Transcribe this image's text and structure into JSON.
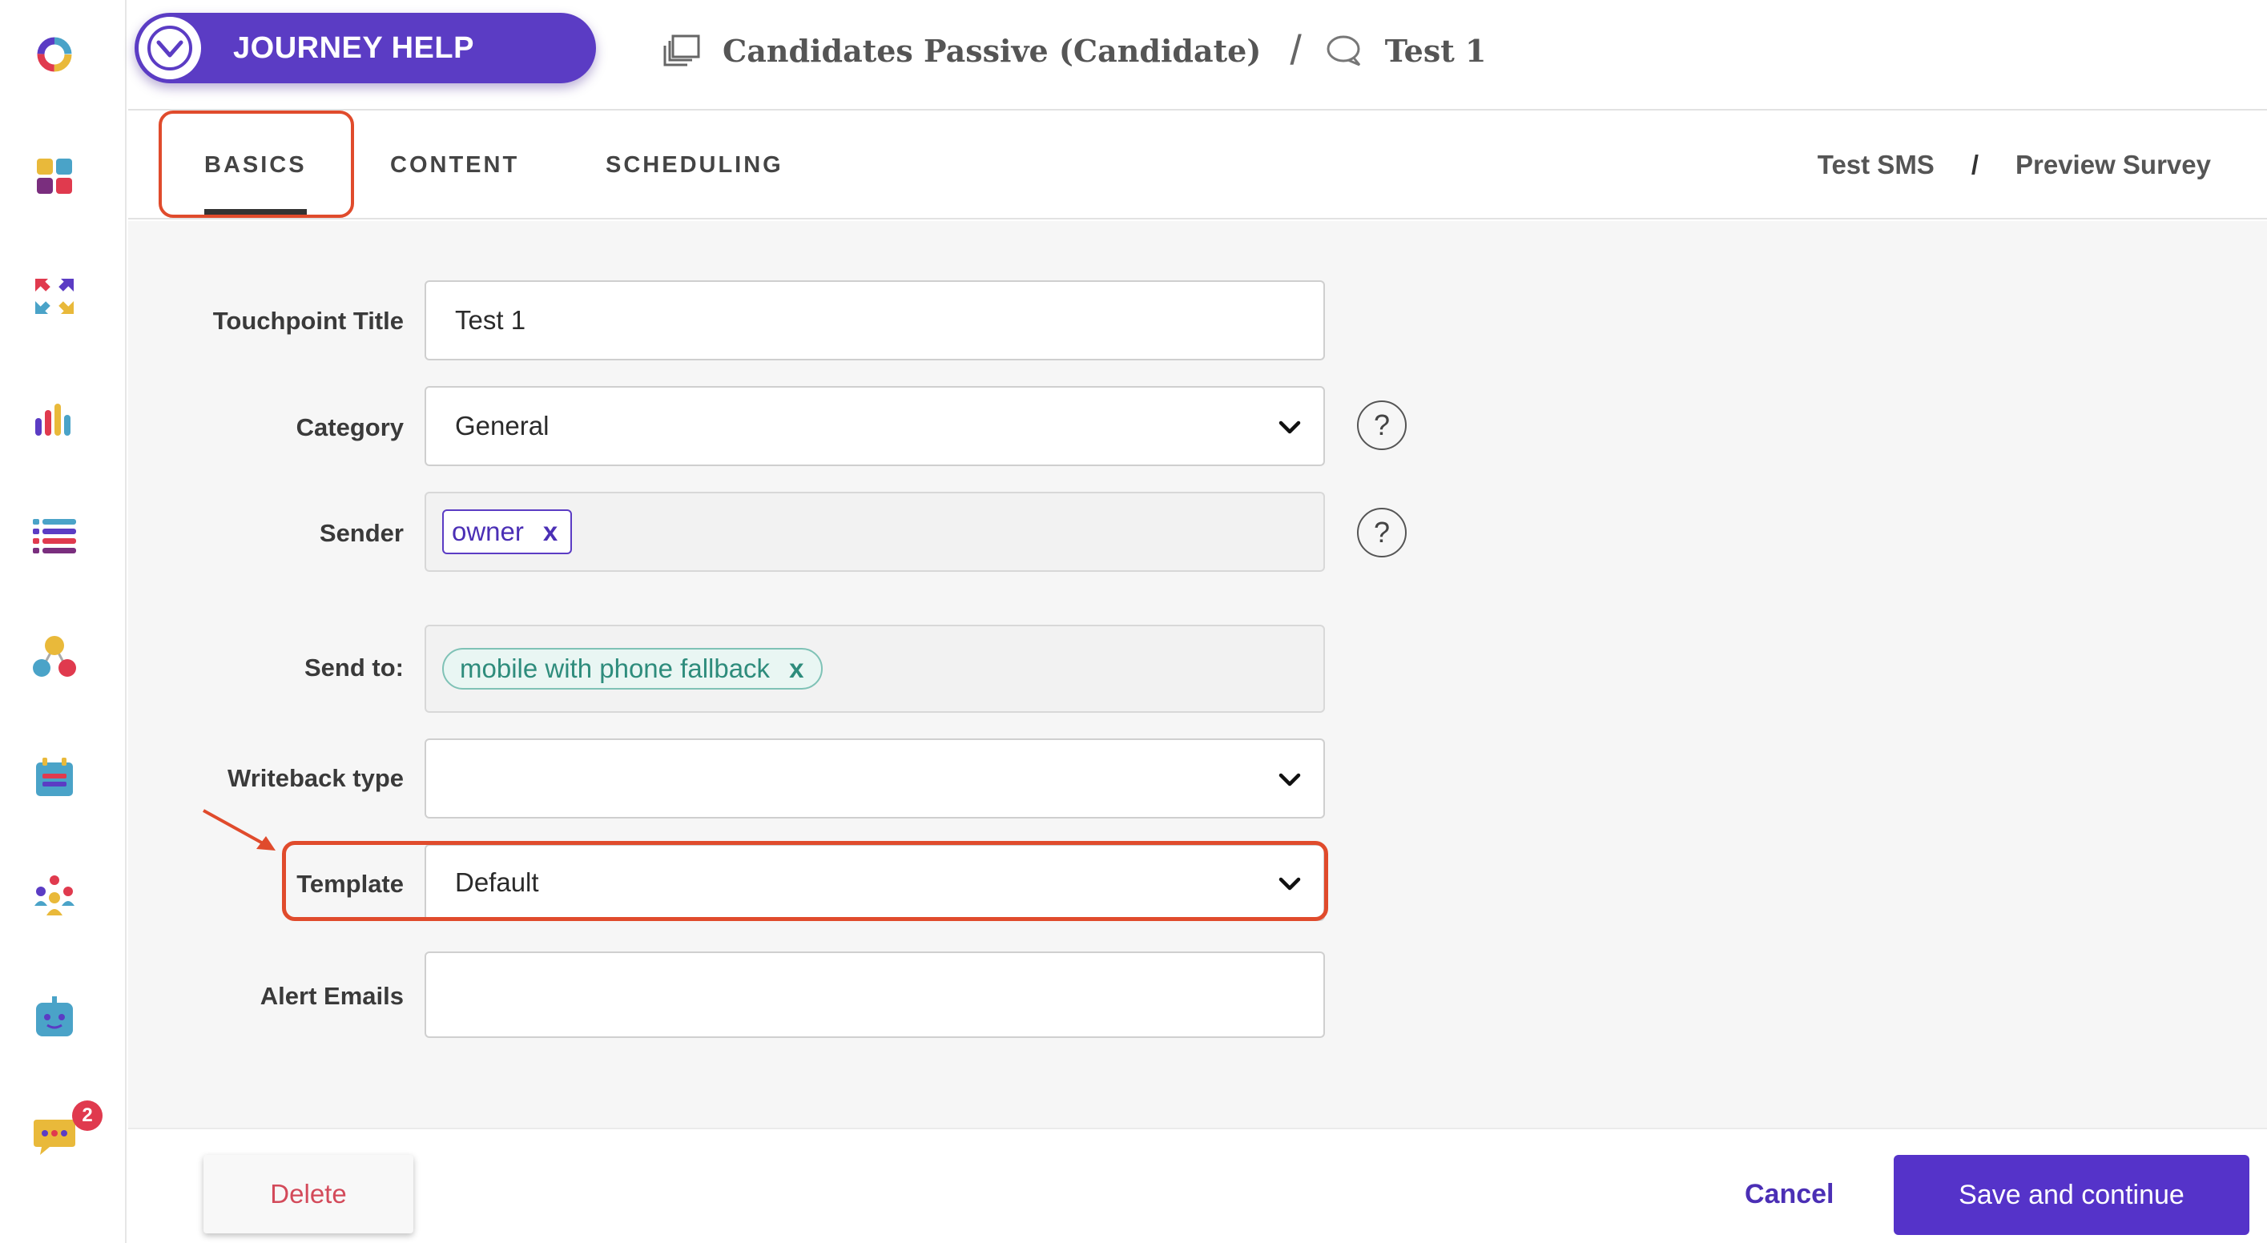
{
  "header": {
    "journey_help_label": "JOURNEY HELP",
    "breadcrumb_journey": "Candidates Passive (Candidate)",
    "breadcrumb_separator": "/",
    "breadcrumb_touchpoint": "Test 1"
  },
  "tabs": [
    {
      "label": "BASICS",
      "active": true
    },
    {
      "label": "CONTENT",
      "active": false
    },
    {
      "label": "SCHEDULING",
      "active": false
    }
  ],
  "header_links": {
    "test_sms": "Test SMS",
    "separator": "/",
    "preview_survey": "Preview Survey"
  },
  "form": {
    "touchpoint_title": {
      "label": "Touchpoint Title",
      "value": "Test 1"
    },
    "category": {
      "label": "Category",
      "value": "General"
    },
    "sender": {
      "label": "Sender",
      "chip": "owner",
      "chip_remove": "x"
    },
    "send_to": {
      "label": "Send to:",
      "chip": "mobile with phone fallback",
      "chip_remove": "x"
    },
    "writeback_type": {
      "label": "Writeback type",
      "value": ""
    },
    "template": {
      "label": "Template",
      "value": "Default"
    },
    "alert_emails": {
      "label": "Alert Emails",
      "value": ""
    },
    "help_glyph": "?"
  },
  "footer": {
    "delete_label": "Delete",
    "cancel_label": "Cancel",
    "save_label": "Save and continue"
  },
  "sidebar": {
    "notification_count": "2",
    "icons": [
      "logo-ring-icon",
      "dashboard-grid-icon",
      "arrows-shuffle-icon",
      "bar-chart-icon",
      "list-icon",
      "network-nodes-icon",
      "calendar-icon",
      "team-icon",
      "bot-icon",
      "chat-icon"
    ]
  },
  "colors": {
    "brand_purple": "#5b3cc4",
    "highlight_red": "#e04b2c",
    "delete_red": "#d34a5a",
    "chip_green": "#2e8c7c"
  }
}
